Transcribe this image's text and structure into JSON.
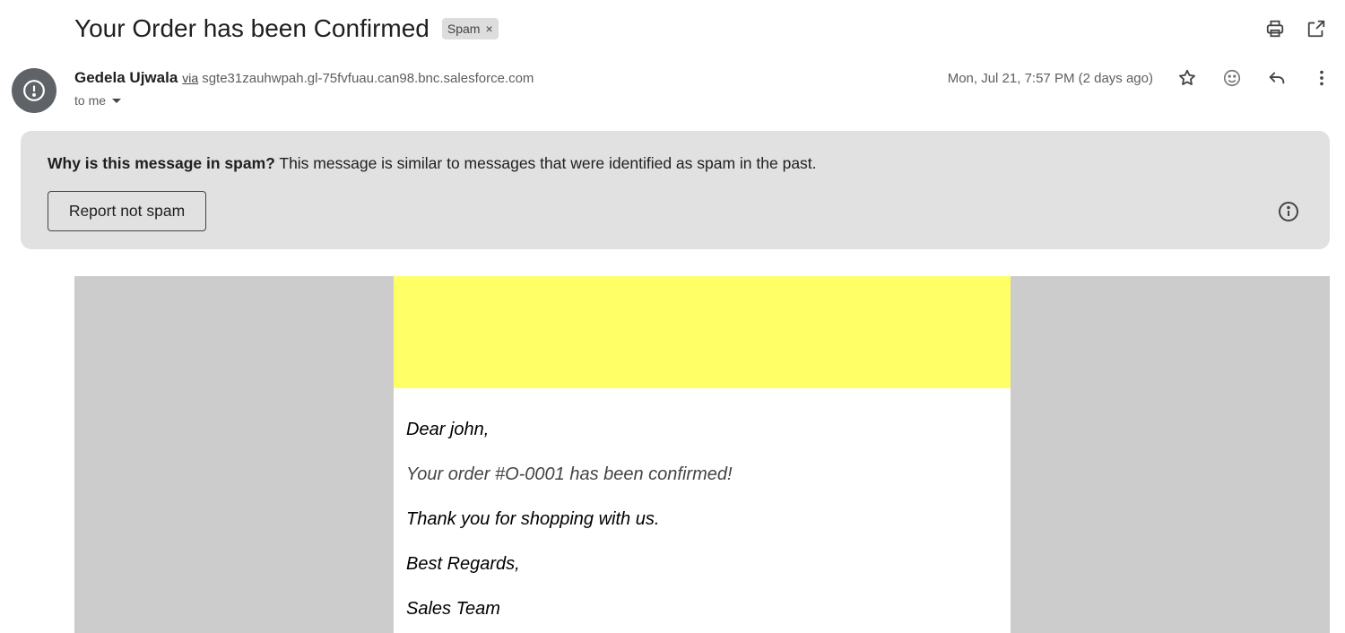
{
  "subject": "Your Order has been Confirmed",
  "spam_chip": {
    "label": "Spam",
    "close": "×"
  },
  "sender": {
    "name": "Gedela Ujwala",
    "via": "via",
    "domain": "sgte31zauhwpah.gl-75fvfuau.can98.bnc.salesforce.com",
    "to": "to me"
  },
  "date": "Mon, Jul 21, 7:57 PM (2 days ago)",
  "spam_banner": {
    "why_bold": "Why is this message in spam?",
    "why_text": " This message is similar to messages that were identified as spam in the past.",
    "report_button": "Report not spam"
  },
  "email": {
    "banner_color": "#ffff66",
    "lines": [
      "Dear john,",
      "Your order #O-0001 has been confirmed!",
      "Thank you for shopping with us.",
      "Best Regards,",
      "Sales Team"
    ]
  },
  "icons": [
    "print-icon",
    "open-new-window-icon",
    "alert-icon",
    "star-icon",
    "emoji-icon",
    "reply-icon",
    "more-vert-icon",
    "info-icon"
  ]
}
